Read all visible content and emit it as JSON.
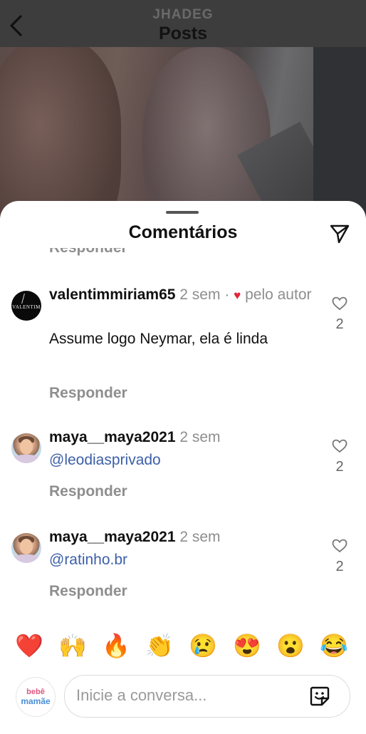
{
  "header": {
    "account_name": "JHADEG",
    "title": "Posts",
    "back_icon": "chevron-left-icon"
  },
  "sheet": {
    "title": "Comentários",
    "share_icon": "paper-plane-icon"
  },
  "comments": [
    {
      "truncated_reply_label": "Responder"
    },
    {
      "avatar": "valentim-brand-avatar",
      "avatar_text": "VALENTIM",
      "username": "valentimmiriam65",
      "time": "2 sem",
      "separator": "·",
      "liked_by_author_heart": "♥",
      "liked_by_author_text": "pelo autor",
      "text": "Assume logo Neymar, ela é linda",
      "reply_label": "Responder",
      "like_count": "2"
    },
    {
      "avatar": "baby-photo-avatar",
      "username": "maya__maya2021",
      "time": "2 sem",
      "mention": "@leodiasprivado",
      "reply_label": "Responder",
      "like_count": "2"
    },
    {
      "avatar": "baby-photo-avatar",
      "username": "maya__maya2021",
      "time": "2 sem",
      "mention": "@ratinho.br",
      "reply_label": "Responder",
      "like_count": "2"
    }
  ],
  "emoji_reactions": [
    "❤️",
    "🙌",
    "🔥",
    "👏",
    "😢",
    "😍",
    "😮",
    "😂"
  ],
  "composer": {
    "brand_line1": "bebê",
    "brand_line2": "mamãe",
    "placeholder": "Inicie a conversa...",
    "sticker_icon": "sticker-icon"
  },
  "colors": {
    "mention": "#3c5fa8",
    "author_heart": "#e0243b",
    "meta_gray": "#8e8e8e"
  }
}
